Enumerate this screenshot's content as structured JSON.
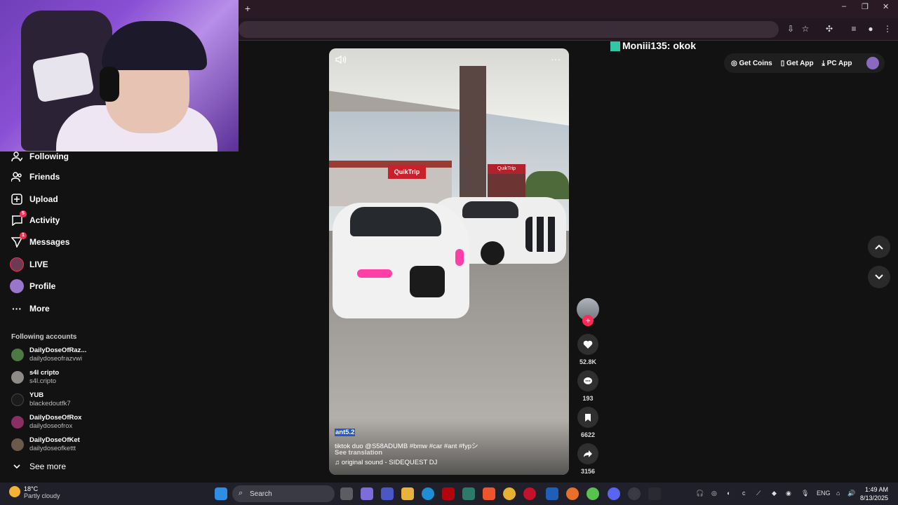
{
  "browser": {
    "new_tab_label": "+",
    "window_controls": [
      "–",
      "❐",
      "✕"
    ]
  },
  "nav": {
    "items": [
      {
        "label": "Following",
        "icon": "following-icon"
      },
      {
        "label": "Friends",
        "icon": "friends-icon"
      },
      {
        "label": "Upload",
        "icon": "upload-icon"
      },
      {
        "label": "Activity",
        "icon": "activity-icon",
        "badge": "5"
      },
      {
        "label": "Messages",
        "icon": "messages-icon",
        "badge": "1"
      },
      {
        "label": "LIVE",
        "icon": "live-icon"
      },
      {
        "label": "Profile",
        "icon": "profile-icon"
      },
      {
        "label": "More",
        "icon": "more-icon"
      }
    ],
    "following_title": "Following accounts",
    "accounts": [
      {
        "name": "DailyDoseOfRaz...",
        "handle": "dailydoseofrazvwi"
      },
      {
        "name": "s4l cripto",
        "handle": "s4l.cripto"
      },
      {
        "name": "YUB",
        "handle": "blackedoutfk7"
      },
      {
        "name": "DailyDoseOfRox",
        "handle": "dailydoseofrox"
      },
      {
        "name": "DailyDoseOfKet",
        "handle": "dailydoseofkettt"
      }
    ],
    "see_more": "See more"
  },
  "video": {
    "sign_text": "QuikTrip",
    "author": "ant5.2",
    "caption": "tiktok duo @S58ADUMB #bmw #car #ant #fypシ",
    "see_translation": "See translation",
    "sound": "♫ original sound - SIDEQUEST DJ",
    "likes": "52.8K",
    "comments": "193",
    "saves": "6622",
    "shares": "3156"
  },
  "chat": {
    "user": "Moniii135",
    "message": "Moniii135: okok"
  },
  "topbar": {
    "get_coins": "Get Coins",
    "get_app": "Get App",
    "pc_app": "PC App"
  },
  "taskbar": {
    "temp": "18°C",
    "weather": "Partly cloudy",
    "search_placeholder": "Search",
    "lang": "ENG",
    "time": "1:49 AM",
    "date": "8/13/2025"
  },
  "colors": {
    "accent": "#fe2c55",
    "background": "#121212"
  }
}
